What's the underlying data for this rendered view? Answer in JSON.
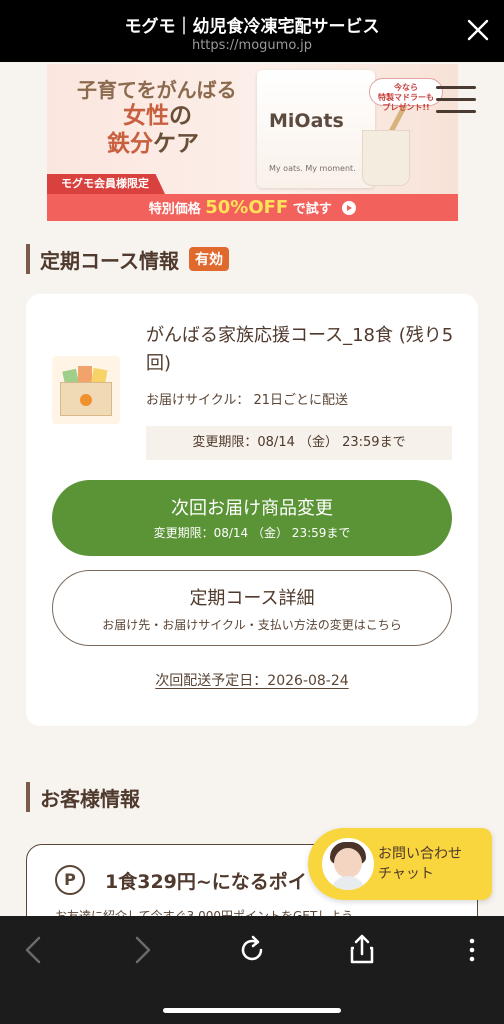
{
  "browser": {
    "title": "モグモ｜幼児食冷凍宅配サービス",
    "url": "https://mogumo.jp"
  },
  "banner": {
    "line1": "子育てをがんばる",
    "line2_main": "女性",
    "line2_suffix": "の",
    "line3_main": "鉄分",
    "line3_suffix": "ケア",
    "member_label": "モグモ会員様限定",
    "product_name": "MiOats",
    "product_tagline": "My oats. My moment.",
    "badge_line1": "今なら",
    "badge_line2": "特製マドラーも",
    "badge_line3": "プレゼント!!",
    "cta_prefix": "特別価格",
    "cta_discount": "50%OFF",
    "cta_suffix": "で試す"
  },
  "course_section": {
    "heading": "定期コース情報",
    "status": "有効"
  },
  "course": {
    "name": "がんばる家族応援コース_18食 (残り5回)",
    "cycle": "お届けサイクル： 21日ごとに配送",
    "deadline": "変更期限：08/14 （金） 23:59まで",
    "change_button_label": "次回お届け商品変更",
    "change_button_sub": "変更期限：08/14 （金） 23:59まで",
    "detail_button_label": "定期コース詳細",
    "detail_button_sub": "お届け先・お届けサイクル・支払い方法の変更はこちら",
    "next_ship": "次回配送予定日：2026-08-24"
  },
  "customer_section": {
    "heading": "お客様情報"
  },
  "customer": {
    "points_icon": "P",
    "points_title": "1食329円~になるポイ",
    "points_sub": "お友達に紹介して今すぐ3,000円ポイントをGETしよう。"
  },
  "chat": {
    "line1": "お問い合わせ",
    "line2": "チャット"
  },
  "icons": {
    "close": "close-icon",
    "menu": "hamburger-icon",
    "back": "chevron-left-icon",
    "forward": "chevron-right-icon",
    "reload": "reload-icon",
    "share": "share-icon",
    "more": "more-vertical-icon"
  },
  "colors": {
    "primary_green": "#5b9437",
    "status_orange": "#e06a2e",
    "chat_yellow": "#f9d53e",
    "text_brown": "#4f3a2d"
  }
}
